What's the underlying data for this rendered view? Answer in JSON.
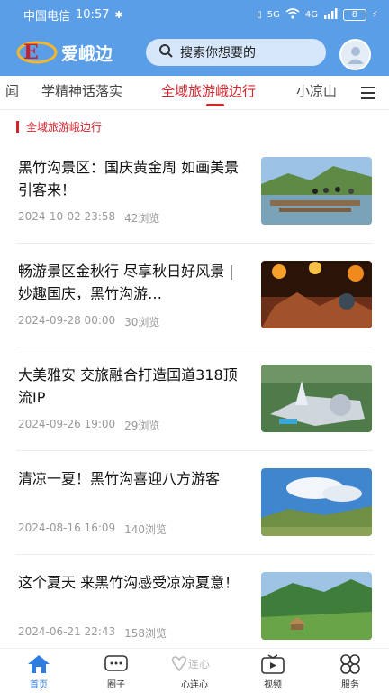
{
  "status_bar": {
    "carrier": "中国电信",
    "time": "10:57",
    "network": "5G",
    "signal": "4G",
    "battery": "8"
  },
  "header": {
    "app_name": "爱峨边",
    "search_placeholder": "搜索你想要的"
  },
  "tabs": [
    {
      "label": "闻"
    },
    {
      "label": "学精神话落实"
    },
    {
      "label": "全域旅游峨边行"
    },
    {
      "label": "小凉山"
    }
  ],
  "section_label": "全域旅游峨边行",
  "news": [
    {
      "title": "黑竹沟景区：国庆黄金周 如画美景引客来！",
      "date": "2024-10-02 23:58",
      "views": "42浏览"
    },
    {
      "title": "畅游景区金秋行 尽享秋日好风景 | 妙趣国庆，黑竹沟游…",
      "date": "2024-09-28 00:00",
      "views": "30浏览"
    },
    {
      "title": "大美雅安 交旅融合打造国道318顶流IP",
      "date": "2024-09-26 19:00",
      "views": "29浏览"
    },
    {
      "title": "清凉一夏！黑竹沟喜迎八方游客",
      "date": "2024-08-16 16:09",
      "views": "140浏览"
    },
    {
      "title": "这个夏天 来黑竹沟感受凉凉夏意！",
      "date": "2024-06-21 22:43",
      "views": "158浏览"
    }
  ],
  "bottom_nav": [
    {
      "label": "首页",
      "icon": "home-icon",
      "active": true
    },
    {
      "label": "圈子",
      "icon": "chat-icon",
      "active": false
    },
    {
      "label": "心连心",
      "icon": "heart-logo-icon",
      "active": false
    },
    {
      "label": "视频",
      "icon": "video-icon",
      "active": false
    },
    {
      "label": "服务",
      "icon": "service-icon",
      "active": false
    }
  ],
  "colors": {
    "header_blue": "#5b9ee8",
    "accent_red": "#d7232b",
    "nav_active": "#2f7de1"
  }
}
